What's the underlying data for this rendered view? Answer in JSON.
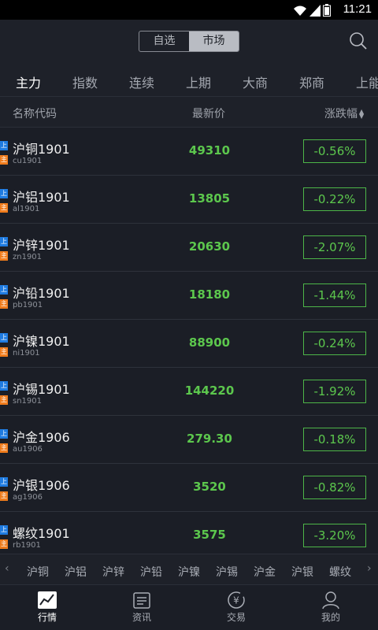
{
  "status": {
    "time": "11:21"
  },
  "segments": [
    "自选",
    "市场"
  ],
  "tabs": [
    "主力",
    "指数",
    "连续",
    "上期",
    "大商",
    "郑商",
    "上能"
  ],
  "columns": {
    "name": "名称代码",
    "price": "最新价",
    "change": "涨跌幅"
  },
  "badges": {
    "exchange": "上",
    "main": "主"
  },
  "rows": [
    {
      "name": "沪铜1901",
      "code": "cu1901",
      "price": "49310",
      "change": "-0.56%"
    },
    {
      "name": "沪铝1901",
      "code": "al1901",
      "price": "13805",
      "change": "-0.22%"
    },
    {
      "name": "沪锌1901",
      "code": "zn1901",
      "price": "20630",
      "change": "-2.07%"
    },
    {
      "name": "沪铅1901",
      "code": "pb1901",
      "price": "18180",
      "change": "-1.44%"
    },
    {
      "name": "沪镍1901",
      "code": "ni1901",
      "price": "88900",
      "change": "-0.24%"
    },
    {
      "name": "沪锡1901",
      "code": "sn1901",
      "price": "144220",
      "change": "-1.92%"
    },
    {
      "name": "沪金1906",
      "code": "au1906",
      "price": "279.30",
      "change": "-0.18%"
    },
    {
      "name": "沪银1906",
      "code": "ag1906",
      "price": "3520",
      "change": "-0.82%"
    },
    {
      "name": "螺纹1901",
      "code": "rb1901",
      "price": "3575",
      "change": "-3.20%"
    }
  ],
  "quick": [
    "沪铜",
    "沪铝",
    "沪锌",
    "沪铅",
    "沪镍",
    "沪锡",
    "沪金",
    "沪银",
    "螺纹"
  ],
  "nav": [
    "行情",
    "资讯",
    "交易",
    "我的"
  ],
  "colors": {
    "down": "#5cc74d",
    "exchange_badge": "#1f7be0",
    "main_badge": "#f07c1c"
  }
}
